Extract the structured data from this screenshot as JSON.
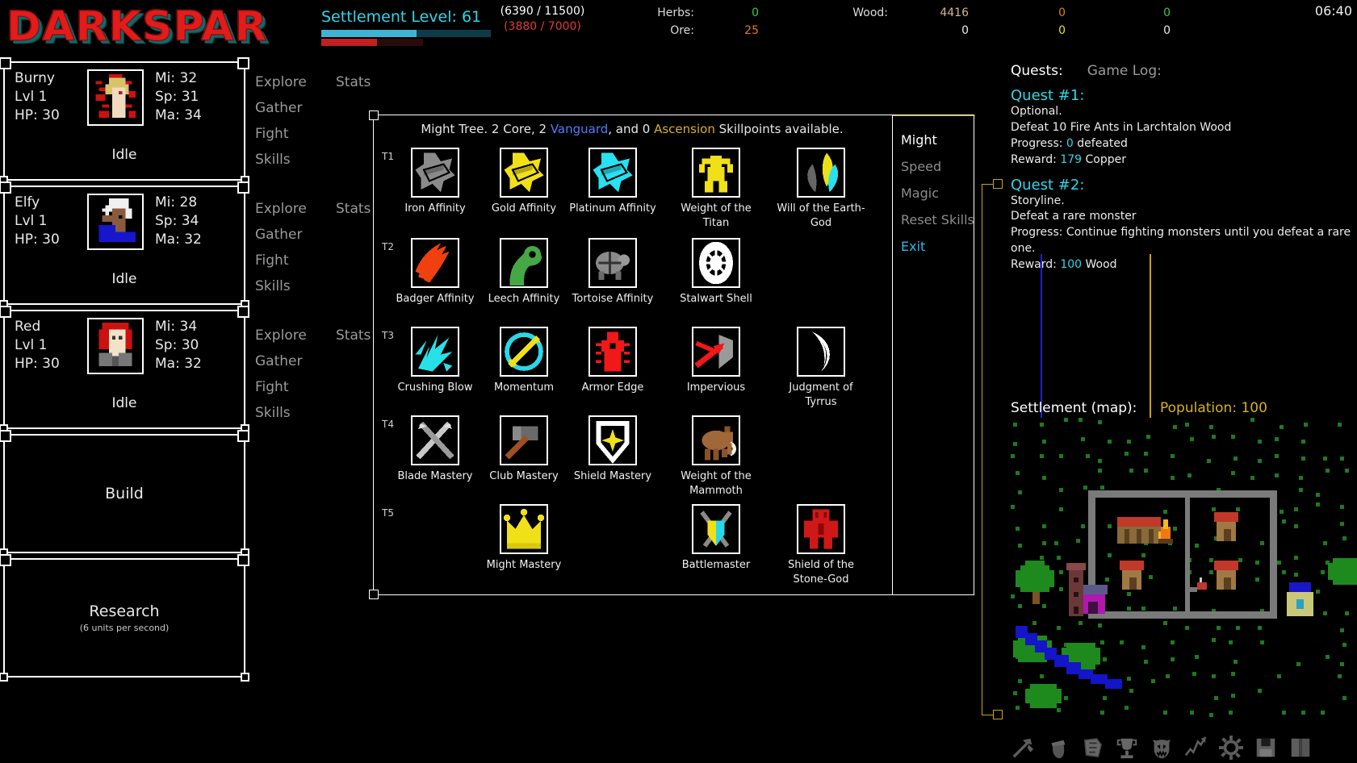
{
  "app": {
    "title": "DARKSPAR",
    "clock": "06:40"
  },
  "topbar": {
    "settlement_label": "Settlement Level: 61",
    "xp_primary": "(6390 / 11500)",
    "xp_secondary": "(3880 / 7000)",
    "bar_primary_pct": 56,
    "bar_secondary_pct": 55,
    "colors": {
      "cyan": "#2fd6e8",
      "bar_blue": "#3fb3d4",
      "bar_blue_track": "#0e3b4a",
      "bar_red": "#c02020",
      "gold": "#d8b218",
      "green": "#3ec93e",
      "orange": "#e08000",
      "yellow": "#e8e020"
    },
    "resources": [
      {
        "name": "Herbs:",
        "value": "0",
        "color": "#3ec93e"
      },
      {
        "name": "Ore:",
        "value": "25",
        "color": "#e08000"
      },
      {
        "name": "Wood:",
        "value": "4416",
        "color": "#d8b38a"
      },
      {
        "name": "",
        "value": "0",
        "color": "#e8e8e8"
      },
      {
        "name": "",
        "value": "0",
        "color": "#e08000"
      },
      {
        "name": "",
        "value": "0",
        "color": "#e8e020"
      },
      {
        "name": "",
        "value": "0",
        "color": "#3ec93e"
      },
      {
        "name": "",
        "value": "0",
        "color": "#e8e8e8"
      }
    ]
  },
  "sidebar": {
    "characters": [
      {
        "name": "Burny",
        "level": "Lvl 1",
        "hp": "HP: 30",
        "mi": "Mi: 32",
        "sp": "Sp: 31",
        "ma": "Ma: 34",
        "status": "Idle"
      },
      {
        "name": "Elfy",
        "level": "Lvl 1",
        "hp": "HP: 30",
        "mi": "Mi: 28",
        "sp": "Sp: 34",
        "ma": "Ma: 32",
        "status": "Idle"
      },
      {
        "name": "Red",
        "level": "Lvl 1",
        "hp": "HP: 30",
        "mi": "Mi: 34",
        "sp": "Sp: 30",
        "ma": "Ma: 32",
        "status": "Idle"
      }
    ],
    "build": {
      "label": "Build"
    },
    "research": {
      "label": "Research",
      "sub": "(6 units per second)"
    }
  },
  "action_menus": {
    "column1": [
      "Explore",
      "Gather",
      "Fight",
      "Skills"
    ],
    "column2": [
      "Stats"
    ]
  },
  "skilltree": {
    "header": {
      "prefix": "Might Tree. 2 Core, 2 ",
      "vanguard": "Vanguard",
      "middle": ", and 0 ",
      "ascension": "Ascension",
      "suffix": " Skillpoints available."
    },
    "menu": [
      {
        "label": "Might",
        "state": "active"
      },
      {
        "label": "Speed",
        "state": "dim"
      },
      {
        "label": "Magic",
        "state": "dim"
      },
      {
        "label": "Reset Skills",
        "state": "dim"
      },
      {
        "label": "Exit",
        "state": "exit"
      }
    ],
    "tiers": [
      {
        "tier": "T1",
        "nodes": [
          {
            "label": "Iron Affinity",
            "icon": "ingot-gray-icon"
          },
          {
            "label": "Gold Affinity",
            "icon": "ingot-gold-icon"
          },
          {
            "label": "Platinum Affinity",
            "icon": "ingot-cyan-icon"
          },
          {
            "label": "Weight of the Titan",
            "icon": "flexing-titan-icon"
          },
          {
            "label": "Will of the Earth-God",
            "icon": "leaves-icon"
          }
        ]
      },
      {
        "tier": "T2",
        "nodes": [
          {
            "label": "Badger Affinity",
            "icon": "claw-slash-icon"
          },
          {
            "label": "Leech Affinity",
            "icon": "leech-icon"
          },
          {
            "label": "Tortoise Affinity",
            "icon": "tortoise-icon"
          },
          {
            "label": "Stalwart Shell",
            "icon": "shell-icon"
          },
          {
            "label": "",
            "icon": ""
          }
        ]
      },
      {
        "tier": "T3",
        "nodes": [
          {
            "label": "Crushing Blow",
            "icon": "shatter-icon"
          },
          {
            "label": "Momentum",
            "icon": "sword-swirl-icon"
          },
          {
            "label": "Armor Edge",
            "icon": "spiked-armor-icon"
          },
          {
            "label": "Impervious",
            "icon": "arrow-shield-icon"
          },
          {
            "label": "Judgment of Tyrrus",
            "icon": "crescent-blade-icon"
          }
        ]
      },
      {
        "tier": "T4",
        "nodes": [
          {
            "label": "Blade Mastery",
            "icon": "crossed-swords-icon"
          },
          {
            "label": "Club Mastery",
            "icon": "hammer-icon"
          },
          {
            "label": "Shield Mastery",
            "icon": "star-shield-icon"
          },
          {
            "label": "Weight of the Mammoth",
            "icon": "mammoth-icon"
          },
          {
            "label": "",
            "icon": ""
          }
        ]
      },
      {
        "tier": "T5",
        "nodes": [
          {
            "label": "",
            "icon": ""
          },
          {
            "label": "Might Mastery",
            "icon": "crown-icon"
          },
          {
            "label": "",
            "icon": ""
          },
          {
            "label": "Battlemaster",
            "icon": "battlemaster-icon"
          },
          {
            "label": "Shield of the Stone-God",
            "icon": "stone-golem-icon"
          }
        ]
      }
    ]
  },
  "rightpanel": {
    "tabs": [
      {
        "label": "Quests:",
        "state": "active"
      },
      {
        "label": "Game Log:",
        "state": "dim"
      }
    ],
    "quests": [
      {
        "title": "Quest #1:",
        "type": "Optional.",
        "objective": "Defeat 10 Fire Ants in Larchtalon Wood",
        "progress_prefix": "Progress: ",
        "progress_value": "0",
        "progress_suffix": " defeated",
        "reward_prefix": "Reward: ",
        "reward_value": "179",
        "reward_suffix": " Copper"
      },
      {
        "title": "Quest #2:",
        "type": "Storyline.",
        "objective": "Defeat a rare monster",
        "progress_prefix": "Progress: Continue fighting monsters until you defeat a rare one.",
        "progress_value": "",
        "progress_suffix": "",
        "reward_prefix": "Reward: ",
        "reward_value": "100",
        "reward_suffix": " Wood"
      }
    ],
    "map": {
      "label": "Settlement (map):",
      "population_label": "Population: 100"
    },
    "toolbar": [
      "pickaxe-icon",
      "acorn-icon",
      "scroll-icon",
      "trophy-icon",
      "demon-head-icon",
      "chart-line-icon",
      "gear-icon",
      "save-icon",
      "book-icon"
    ]
  }
}
